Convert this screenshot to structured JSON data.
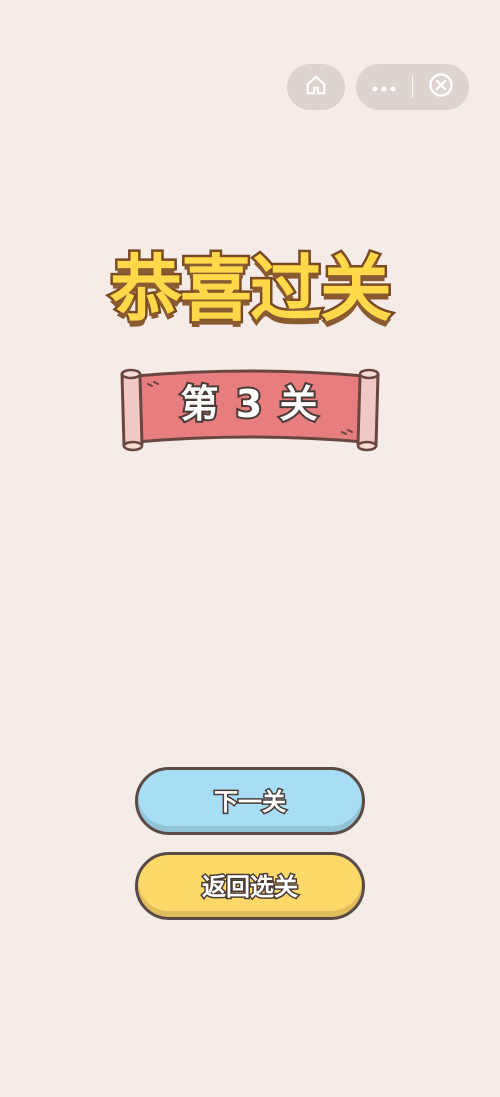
{
  "topbar": {
    "home_icon": "home-icon",
    "more_icon": "more-dots-icon",
    "close_icon": "close-circle-icon"
  },
  "title": "恭喜过关",
  "banner": {
    "text": "第 3 关"
  },
  "buttons": {
    "next_label": "下一关",
    "back_label": "返回选关"
  },
  "colors": {
    "background": "#f5ebe7",
    "title_fill": "#ffd94a",
    "banner_fill": "#e87d80",
    "next_button": "#a8def5",
    "back_button": "#ffd86a"
  }
}
